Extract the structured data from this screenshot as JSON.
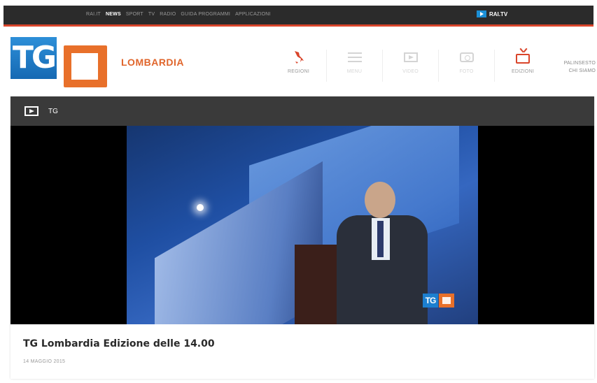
{
  "topbar": {
    "nav": [
      "RAI.IT",
      "NEWS",
      "SPORT",
      "TV",
      "RADIO",
      "GUIDA PROGRAMMI",
      "APPLICAZIONI"
    ],
    "active": "NEWS",
    "raitv_label": "RAI.TV"
  },
  "header": {
    "logo_text": "TG",
    "region": "LOMBARDIA",
    "nav_icons": [
      {
        "icon": "italy-map-icon",
        "label": "REGIONI"
      },
      {
        "icon": "menu-icon",
        "label": "MENU"
      },
      {
        "icon": "video-icon",
        "label": "VIDEO"
      },
      {
        "icon": "camera-icon",
        "label": "FOTO"
      },
      {
        "icon": "tv-icon",
        "label": "EDIZIONI"
      }
    ],
    "side_links": [
      "PALINSESTO",
      "CHI SIAMO"
    ]
  },
  "card": {
    "bar_label": "TG",
    "watermark": "TG",
    "video_title": "TG Lombardia Edizione delle 14.00",
    "date": "14 MAGGIO 2015"
  },
  "colors": {
    "accent": "#d9452b",
    "region": "#e0652b",
    "brand_blue": "#1c7fd0",
    "brand_orange": "#e8702a"
  }
}
